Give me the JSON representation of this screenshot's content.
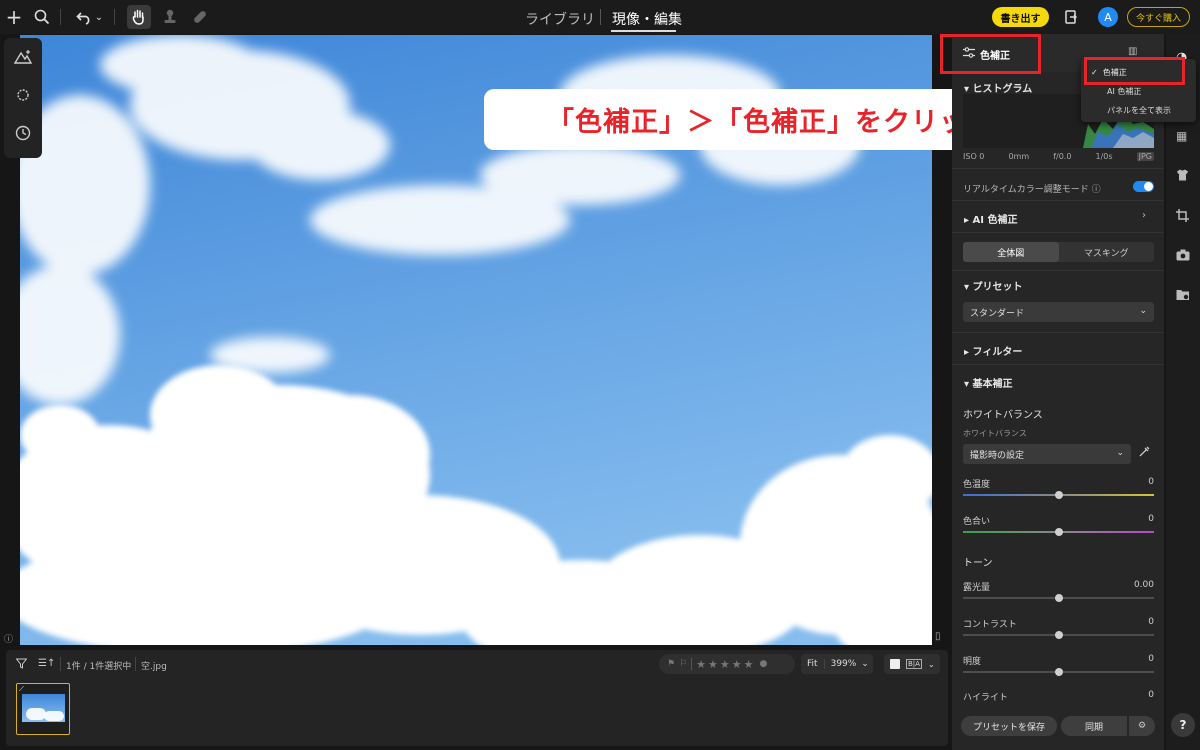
{
  "toolbar": {
    "add_icon": "+",
    "tabs": [
      "ライブラリ",
      "現像・編集"
    ],
    "export_label": "書き出す",
    "avatar_letter": "A",
    "buy_label": "今すぐ購入"
  },
  "photo": {
    "sky_top": "#4a8fdc",
    "sky_bottom": "#7db8ee"
  },
  "filmstrip": {
    "selection": "1件 / 1件選択中",
    "filename": "空.jpg",
    "fit_label": "Fit",
    "zoom": "399%",
    "compare_label": "B|A"
  },
  "panel": {
    "header_title": "色補正",
    "histogram_title": "ヒストグラム",
    "exif": [
      "ISO 0",
      "0mm",
      "f/0.0",
      "1/0s",
      "JPG"
    ],
    "realtime_label": "リアルタイムカラー調整モード",
    "ai_section": "AI 色補正",
    "tabs": [
      "全体図",
      "マスキング"
    ],
    "preset_section": "プリセット",
    "preset_value": "スタンダード",
    "filter_section": "フィルター",
    "basic_section": "基本補正",
    "wb_heading": "ホワイトバランス",
    "wb_label": "ホワイトバランス",
    "wb_value": "撮影時の設定",
    "tone_heading": "トーン",
    "sliders": [
      {
        "label": "色温度",
        "value": "0",
        "level": 0.5
      },
      {
        "label": "色合い",
        "value": "0",
        "level": 0.5
      },
      {
        "label": "露光量",
        "value": "0.00",
        "level": 0.5
      },
      {
        "label": "コントラスト",
        "value": "0",
        "level": 0.5
      },
      {
        "label": "明度",
        "value": "0",
        "level": 0.5
      },
      {
        "label": "ハイライト",
        "value": "0",
        "level": 0.5
      }
    ],
    "save_preset": "プリセットを保存",
    "sync": "同期"
  },
  "menu": {
    "items": [
      "色補正",
      "AI 色補正",
      "パネルを全て表示"
    ]
  },
  "annotation": {
    "text": "「色補正」＞「色補正」をクリック"
  },
  "colors": {
    "accent": "#1f8bf2",
    "export_bg": "#f5d90a",
    "annotation_red": "#e8232a"
  }
}
